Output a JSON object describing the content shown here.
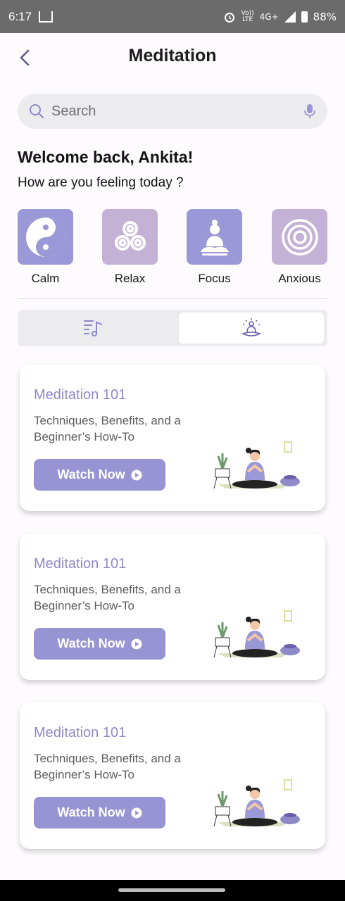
{
  "status_bar": {
    "time": "6:17",
    "network": "4G+",
    "carrier_line1": "Vo))",
    "carrier_line2": "LTE",
    "battery": "88%"
  },
  "header": {
    "title": "Meditation",
    "back_icon": "chevron-left-icon"
  },
  "search": {
    "placeholder": "Search",
    "value": "",
    "search_icon": "search-icon",
    "mic_icon": "mic-icon"
  },
  "greeting": {
    "welcome": "Welcome back, Ankita!",
    "question": "How are you feeling today ?"
  },
  "moods": [
    {
      "label": "Calm",
      "icon": "yin-yang-icon",
      "color": "#9a98d6"
    },
    {
      "label": "Relax",
      "icon": "triskelion-icon",
      "color": "#c4b2d6"
    },
    {
      "label": "Focus",
      "icon": "buddha-icon",
      "color": "#9a98d6"
    },
    {
      "label": "Anxious",
      "icon": "spiral-icon",
      "color": "#c4b2d6"
    }
  ],
  "tabs": [
    {
      "icon": "music-list-icon",
      "active": false
    },
    {
      "icon": "lotus-meditation-icon",
      "active": true
    }
  ],
  "cards": [
    {
      "title": "Meditation 101",
      "description": "Techniques, Benefits, and a Beginner’s How-To",
      "button": "Watch Now"
    },
    {
      "title": "Meditation 101",
      "description": "Techniques, Benefits, and a Beginner’s How-To",
      "button": "Watch Now"
    },
    {
      "title": "Meditation 101",
      "description": "Techniques, Benefits, and a Beginner’s How-To",
      "button": "Watch Now"
    }
  ],
  "colors": {
    "accent": "#9894d4",
    "accent_text": "#8d89c9",
    "tile_purple": "#9a98d6",
    "tile_lilac": "#c4b2d6"
  }
}
